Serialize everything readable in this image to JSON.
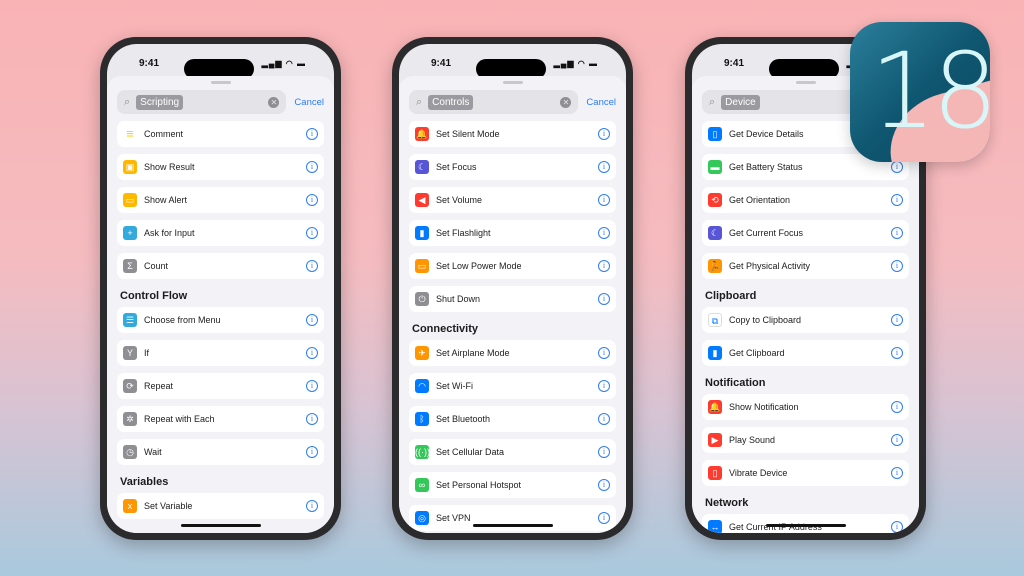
{
  "status_time": "9:41",
  "cancel_label": "Cancel",
  "logo_text": "18",
  "phones": [
    {
      "search_token": "Scripting",
      "items": [
        {
          "label": "Comment",
          "icon": "comment-icon",
          "glyph": "≡",
          "color": "#ffcc00"
        },
        {
          "label": "Show Result",
          "icon": "show-result-icon",
          "glyph": "▣",
          "color": "#ffb800"
        },
        {
          "label": "Show Alert",
          "icon": "show-alert-icon",
          "glyph": "▭",
          "color": "#ffb800"
        },
        {
          "label": "Ask for Input",
          "icon": "ask-input-icon",
          "glyph": "+",
          "color": "#33aadd"
        },
        {
          "label": "Count",
          "icon": "sum-icon",
          "glyph": "Σ",
          "color": "#8e8e93"
        },
        {
          "header": "Control Flow"
        },
        {
          "label": "Choose from Menu",
          "icon": "menu-icon",
          "glyph": "☰",
          "color": "#33aadd"
        },
        {
          "label": "If",
          "icon": "branch-icon",
          "glyph": "Y",
          "color": "#8e8e93"
        },
        {
          "label": "Repeat",
          "icon": "repeat-icon",
          "glyph": "⟳",
          "color": "#8e8e93"
        },
        {
          "label": "Repeat with Each",
          "icon": "repeat-each-icon",
          "glyph": "✲",
          "color": "#8e8e93"
        },
        {
          "label": "Wait",
          "icon": "clock-icon",
          "glyph": "◷",
          "color": "#8e8e93"
        },
        {
          "header": "Variables"
        },
        {
          "label": "Set Variable",
          "icon": "variable-icon",
          "glyph": "x",
          "color": "#ff9500"
        }
      ]
    },
    {
      "search_token": "Controls",
      "items": [
        {
          "label": "Set Silent Mode",
          "icon": "bell-icon",
          "glyph": "🔔",
          "color": "#ff3b30"
        },
        {
          "label": "Set Focus",
          "icon": "moon-icon",
          "glyph": "☾",
          "color": "#5856d6"
        },
        {
          "label": "Set Volume",
          "icon": "speaker-icon",
          "glyph": "◀",
          "color": "#ff3b30"
        },
        {
          "label": "Set Flashlight",
          "icon": "flashlight-icon",
          "glyph": "▮",
          "color": "#007aff"
        },
        {
          "label": "Set Low Power Mode",
          "icon": "battery-icon",
          "glyph": "▭",
          "color": "#ff9500"
        },
        {
          "label": "Shut Down",
          "icon": "power-icon",
          "glyph": "⏻",
          "color": "#8e8e93"
        },
        {
          "header": "Connectivity"
        },
        {
          "label": "Set Airplane Mode",
          "icon": "airplane-icon",
          "glyph": "✈",
          "color": "#ff9500"
        },
        {
          "label": "Set Wi-Fi",
          "icon": "wifi-icon",
          "glyph": "◠",
          "color": "#007aff"
        },
        {
          "label": "Set Bluetooth",
          "icon": "bluetooth-icon",
          "glyph": "ᛒ",
          "color": "#007aff"
        },
        {
          "label": "Set Cellular Data",
          "icon": "cellular-icon",
          "glyph": "((·))",
          "color": "#34c759"
        },
        {
          "label": "Set Personal Hotspot",
          "icon": "hotspot-icon",
          "glyph": "∞",
          "color": "#34c759"
        },
        {
          "label": "Set VPN",
          "icon": "vpn-icon",
          "glyph": "◎",
          "color": "#007aff"
        }
      ]
    },
    {
      "search_token": "Device",
      "items": [
        {
          "label": "Get Device Details",
          "icon": "phone-icon",
          "glyph": "▯",
          "color": "#007aff"
        },
        {
          "label": "Get Battery Status",
          "icon": "battery-icon",
          "glyph": "▬",
          "color": "#34c759"
        },
        {
          "label": "Get Orientation",
          "icon": "orientation-icon",
          "glyph": "⟲",
          "color": "#ff3b30"
        },
        {
          "label": "Get Current Focus",
          "icon": "moon-icon",
          "glyph": "☾",
          "color": "#5856d6"
        },
        {
          "label": "Get Physical Activity",
          "icon": "activity-icon",
          "glyph": "🏃",
          "color": "#ff9500"
        },
        {
          "header": "Clipboard"
        },
        {
          "label": "Copy to Clipboard",
          "icon": "copy-icon",
          "glyph": "⧉",
          "color": "#ffffff"
        },
        {
          "label": "Get Clipboard",
          "icon": "clipboard-icon",
          "glyph": "▮",
          "color": "#007aff"
        },
        {
          "header": "Notification"
        },
        {
          "label": "Show Notification",
          "icon": "notification-icon",
          "glyph": "🔔",
          "color": "#ff3b30"
        },
        {
          "label": "Play Sound",
          "icon": "play-icon",
          "glyph": "▶",
          "color": "#ff3b30"
        },
        {
          "label": "Vibrate Device",
          "icon": "vibrate-icon",
          "glyph": "▯",
          "color": "#ff3b30"
        },
        {
          "header": "Network"
        },
        {
          "label": "Get Current IP Address",
          "icon": "network-icon",
          "glyph": "↔",
          "color": "#007aff"
        }
      ]
    }
  ]
}
